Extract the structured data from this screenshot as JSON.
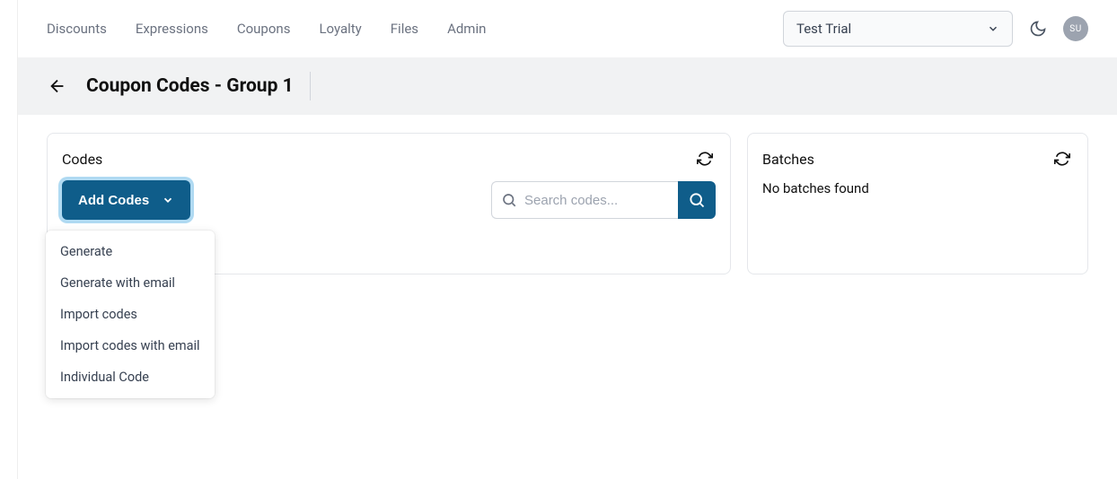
{
  "nav": {
    "items": [
      "Discounts",
      "Expressions",
      "Coupons",
      "Loyalty",
      "Files",
      "Admin"
    ]
  },
  "header": {
    "account_selected": "Test Trial",
    "avatar_initials": "SU"
  },
  "page": {
    "title": "Coupon Codes - Group 1"
  },
  "codes": {
    "title": "Codes",
    "add_button": "Add Codes",
    "search_placeholder": "Search codes...",
    "dropdown": {
      "items": [
        "Generate",
        "Generate with email",
        "Import codes",
        "Import codes with email",
        "Individual Code"
      ]
    }
  },
  "batches": {
    "title": "Batches",
    "empty_text": "No batches found"
  }
}
